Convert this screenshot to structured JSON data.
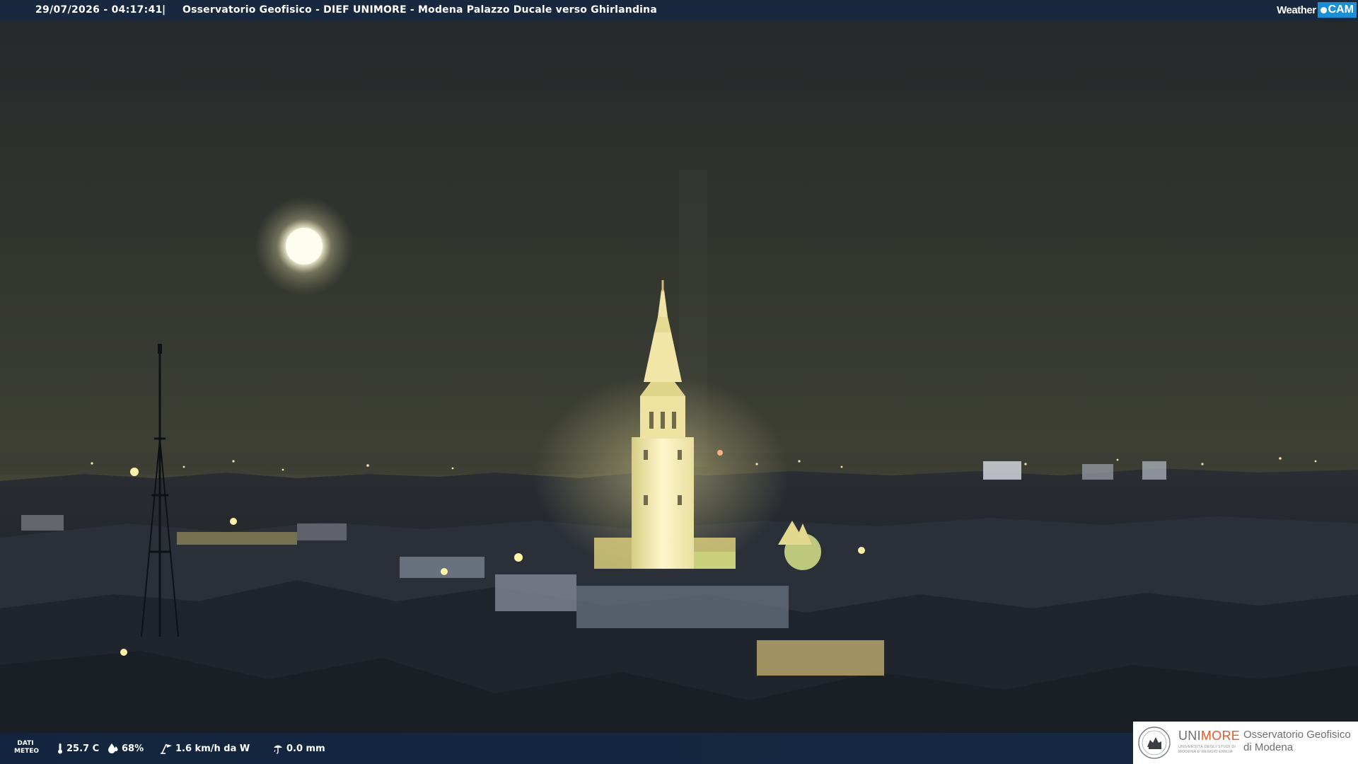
{
  "top_bar": {
    "timestamp": "29/07/2026 - 04:17:41",
    "separator": "|",
    "title": "Osservatorio Geofisico - DIEF UNIMORE - Modena Palazzo Ducale verso Ghirlandina",
    "logo": {
      "weather_text": "Weather",
      "cam_text": "CAM",
      "accent_color": "#1a8fd6"
    }
  },
  "scene": {
    "sky_color": "#3d3f33",
    "tower_light_color": "#fff6c8",
    "moon_color": "#fffbe6"
  },
  "bottom_bar": {
    "dati_meteo_line1": "DATI",
    "dati_meteo_line2": "METEO",
    "temperature": "25.7 C",
    "humidity": "68%",
    "wind": "1.6 km/h da W",
    "rain": "0.0 mm",
    "icons": [
      "thermometer-icon",
      "humidity-drop-icon",
      "wind-vane-icon",
      "rain-gauge-icon"
    ]
  },
  "logo_unimore": {
    "word_prefix": "UNI",
    "word_suffix": "MORE",
    "subtitle": "UNIVERSITÀ DEGLI STUDI DI MODENA E REGGIO EMILIA",
    "osservatorio_line1": "Osservatorio Geofisico",
    "osservatorio_line2": "di Modena",
    "accent_color": "#e05a2a"
  }
}
